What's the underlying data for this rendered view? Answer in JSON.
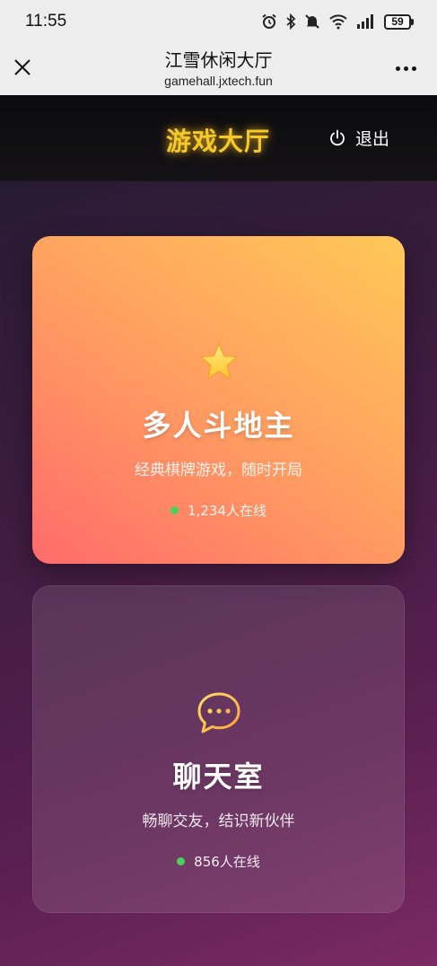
{
  "status_bar": {
    "time": "11:55",
    "icons": [
      "alarm-icon",
      "bluetooth-icon",
      "mute-icon",
      "wifi-icon",
      "signal-icon"
    ],
    "battery": "59"
  },
  "browser": {
    "title": "江雪休闲大厅",
    "url": "gamehall.jxtech.fun"
  },
  "header": {
    "title": "游戏大厅",
    "logout_label": "退出",
    "title_color": "#f5c928"
  },
  "cards": [
    {
      "icon": "star-icon",
      "title": "多人斗地主",
      "description": "经典棋牌游戏，随时开局",
      "online": "1,234人在线"
    },
    {
      "icon": "chat-bubble-icon",
      "title": "聊天室",
      "description": "畅聊交友，结识新伙伴",
      "online": "856人在线"
    }
  ],
  "colors": {
    "online_dot": "#4cd05a",
    "ddz_gradient": [
      "#ff6b6b",
      "#ff9a62",
      "#ffc857"
    ]
  }
}
